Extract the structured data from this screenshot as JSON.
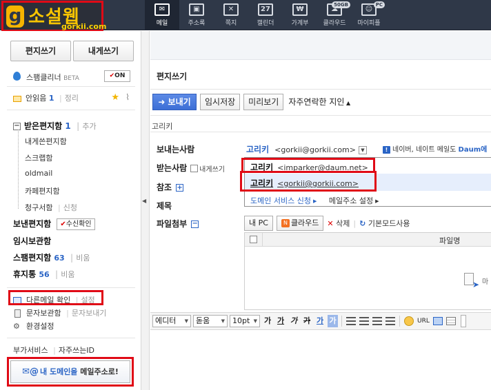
{
  "logo": {
    "name": "소설웹",
    "sub": "gorkii.com",
    "mark": "g"
  },
  "nav": [
    {
      "label": "메일",
      "icon": "mail-icon",
      "glyph": "✉",
      "active": true
    },
    {
      "label": "주소록",
      "icon": "address-book-icon",
      "glyph": "▣"
    },
    {
      "label": "쪽지",
      "icon": "memo-icon",
      "glyph": "✕"
    },
    {
      "label": "캘린더",
      "icon": "calendar-icon",
      "glyph": "27"
    },
    {
      "label": "가계부",
      "icon": "money-icon",
      "glyph": "₩"
    },
    {
      "label": "클라우드",
      "icon": "cloud-icon",
      "glyph": "☁",
      "badge": "50GB"
    },
    {
      "label": "마이피플",
      "icon": "mypeople-icon",
      "glyph": "☺",
      "badge": "PC"
    }
  ],
  "sidebar": {
    "write_button": "편지쓰기",
    "write_self_button": "내게쓰기",
    "spam_cleaner": "스팸클리너",
    "spam_beta": "BETA",
    "spam_toggle": "ON",
    "unread_label": "안읽음",
    "unread_count": "1",
    "cleanup": "정리",
    "folders": {
      "inbox": "받은편지함",
      "inbox_count": "1",
      "add": "추가",
      "self_mail": "내게쓴편지함",
      "scrap": "스크랩함",
      "oldmail": "oldmail",
      "cafe": "카페편지함",
      "bill": "청구서함",
      "bill_action": "신청",
      "sent": "보낸편지함",
      "receipt_check": "수신확인",
      "drafts": "임시보관함",
      "spam": "스팸편지함",
      "spam_count": "63",
      "empty": "비움",
      "trash": "휴지통",
      "trash_count": "56",
      "empty2": "비움"
    },
    "other_mail": "다른메일 확인",
    "other_mail_setting": "설정",
    "sms_box": "문자보관함",
    "sms_send": "문자보내기",
    "settings": "환경설정",
    "addon_service": "부가서비스",
    "frequent_id": "자주쓰는ID",
    "domain_button_pre": "내 도메인을",
    "domain_button_post": "메일주소로!"
  },
  "compose": {
    "title": "편지쓰기",
    "send_button": "보내기",
    "save_draft_button": "임시저장",
    "preview_button": "미리보기",
    "frequent_contacts": "자주연락한 지인",
    "subject_preview": "고리키",
    "labels": {
      "sender": "보내는사람",
      "recipient": "받는사람",
      "self": "내게쓰기",
      "cc": "참조",
      "subject": "제목",
      "attachment": "파일첨부"
    },
    "sender_name": "고리키",
    "sender_email": "<gorkii@gorkii.com>",
    "notice_pre": "네이버, 네이트 메일도",
    "notice_brand": "Daum에",
    "dropdown": {
      "option1_name": "고리키",
      "option1_email": "<imparker@daum.net>",
      "option2_name": "고리키",
      "option2_email": "<gorkii@gorkii.com>",
      "link_domain": "도메인 서비스 신청",
      "link_mail_setting": "메일주소 설정"
    },
    "attach": {
      "my_pc": "내 PC",
      "cloud": "클라우드",
      "delete": "삭제",
      "basic_mode": "기본모드사용",
      "column_filename": "파일명",
      "drop_hint": "마"
    },
    "editor": {
      "mode": "에디터",
      "font": "돋움",
      "size": "10pt",
      "bold": "가",
      "underline": "가",
      "italic": "가",
      "strike": "가",
      "color": "가",
      "bgcolor": "가",
      "url": "URL"
    }
  }
}
